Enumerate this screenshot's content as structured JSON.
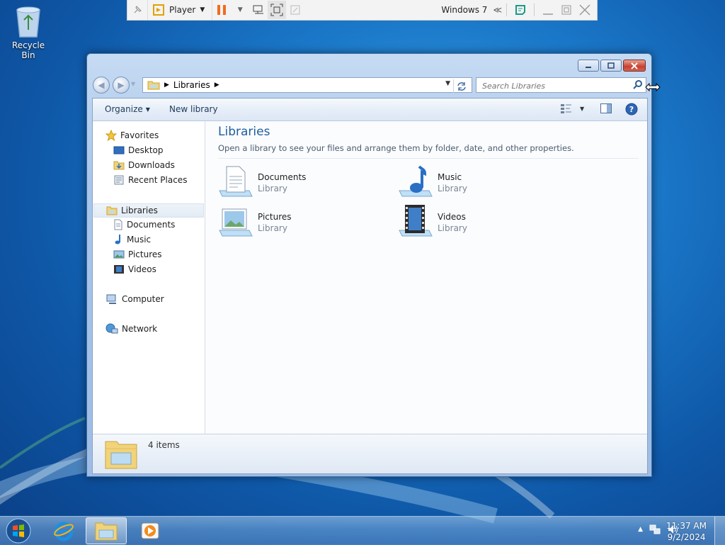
{
  "desktop": {
    "recycle_bin_label": "Recycle Bin"
  },
  "vmware": {
    "player_label": "Player",
    "vm_title": "Windows 7",
    "collapse_glyph": "≪"
  },
  "explorer": {
    "address": {
      "breadcrumb": "Libraries"
    },
    "search": {
      "placeholder": "Search Libraries"
    },
    "toolbar": {
      "organize_label": "Organize",
      "new_library_label": "New library"
    },
    "nav": {
      "favorites": "Favorites",
      "desktop": "Desktop",
      "downloads": "Downloads",
      "recent_places": "Recent Places",
      "libraries": "Libraries",
      "documents": "Documents",
      "music": "Music",
      "pictures": "Pictures",
      "videos": "Videos",
      "computer": "Computer",
      "network": "Network"
    },
    "main": {
      "title": "Libraries",
      "subtitle": "Open a library to see your files and arrange them by folder, date, and other properties.",
      "libraries": [
        {
          "name": "Documents",
          "kind": "Library",
          "icon": "documents-library-icon"
        },
        {
          "name": "Music",
          "kind": "Library",
          "icon": "music-library-icon"
        },
        {
          "name": "Pictures",
          "kind": "Library",
          "icon": "pictures-library-icon"
        },
        {
          "name": "Videos",
          "kind": "Library",
          "icon": "videos-library-icon"
        }
      ]
    },
    "details": {
      "item_count": "4 items"
    }
  },
  "taskbar": {
    "time": "11:37 AM",
    "date": "9/2/2024"
  },
  "colors": {
    "title_accent": "#1e5e9b",
    "close_button": "#c84031"
  }
}
